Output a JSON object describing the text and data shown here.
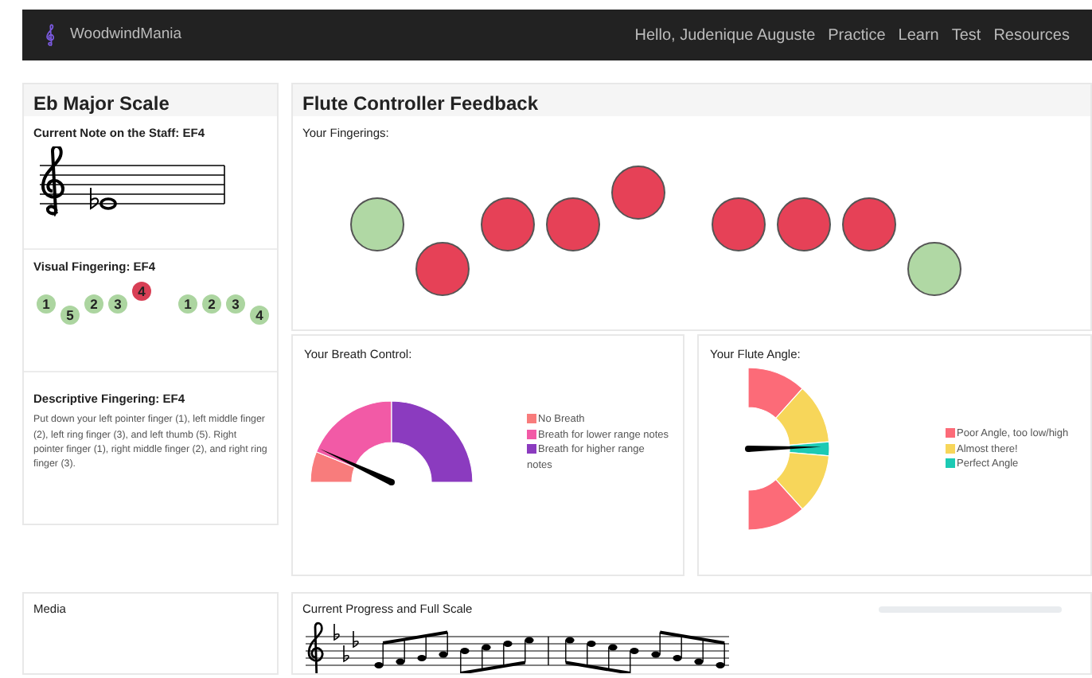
{
  "navbar": {
    "brand": "WoodwindMania",
    "links": [
      {
        "label": "Hello, Judenique Auguste"
      },
      {
        "label": "Practice"
      },
      {
        "label": "Learn"
      },
      {
        "label": "Test"
      },
      {
        "label": "Resources"
      }
    ]
  },
  "scale_panel": {
    "title": "Eb Major Scale",
    "staff": {
      "label": "Current Note on the Staff: EF4"
    },
    "visual_fingering": {
      "label": "Visual Fingering: EF4",
      "keys": [
        {
          "label": "1",
          "color": "#acd5a0"
        },
        {
          "label": "5",
          "color": "#acd5a0"
        },
        {
          "label": "2",
          "color": "#acd5a0"
        },
        {
          "label": "3",
          "color": "#acd5a0"
        },
        {
          "label": "4",
          "color": "#d83f55"
        },
        {
          "label": "1",
          "color": "#acd5a0"
        },
        {
          "label": "2",
          "color": "#acd5a0"
        },
        {
          "label": "3",
          "color": "#acd5a0"
        },
        {
          "label": "4",
          "color": "#acd5a0"
        }
      ]
    },
    "descriptive": {
      "label": "Descriptive Fingering: EF4",
      "text": "Put down your left pointer finger (1), left middle finger (2), left ring finger (3), and left thumb (5). Right pointer finger (1), right middle finger (2), and right ring finger (3)."
    }
  },
  "feedback": {
    "title": "Flute Controller Feedback",
    "fingerings": {
      "label": "Your Fingerings:",
      "keys": [
        {
          "color": "#b0d8a4"
        },
        {
          "color": "#e64157"
        },
        {
          "color": "#e64157"
        },
        {
          "color": "#e64157"
        },
        {
          "color": "#e64157"
        },
        {
          "color": "#e64157"
        },
        {
          "color": "#e64157"
        },
        {
          "color": "#e64157"
        },
        {
          "color": "#b0d8a4"
        }
      ]
    },
    "breath": {
      "label": "Your Breath Control:",
      "legend": [
        {
          "label": "No Breath",
          "color": "#f87c7c"
        },
        {
          "label": "Breath for lower range notes",
          "color": "#f25aa6"
        },
        {
          "label": "Breath for higher range notes",
          "color": "#8b3bbf"
        }
      ]
    },
    "angle": {
      "label": "Your Flute Angle:",
      "legend": [
        {
          "label": "Poor Angle, too low/high",
          "color": "#fc6b78"
        },
        {
          "label": "Almost there!",
          "color": "#f7d65a"
        },
        {
          "label": "Perfect Angle",
          "color": "#1ccab4"
        }
      ]
    }
  },
  "media": {
    "title": "Media"
  },
  "progress": {
    "title": "Current Progress and Full Scale",
    "level": 0
  }
}
